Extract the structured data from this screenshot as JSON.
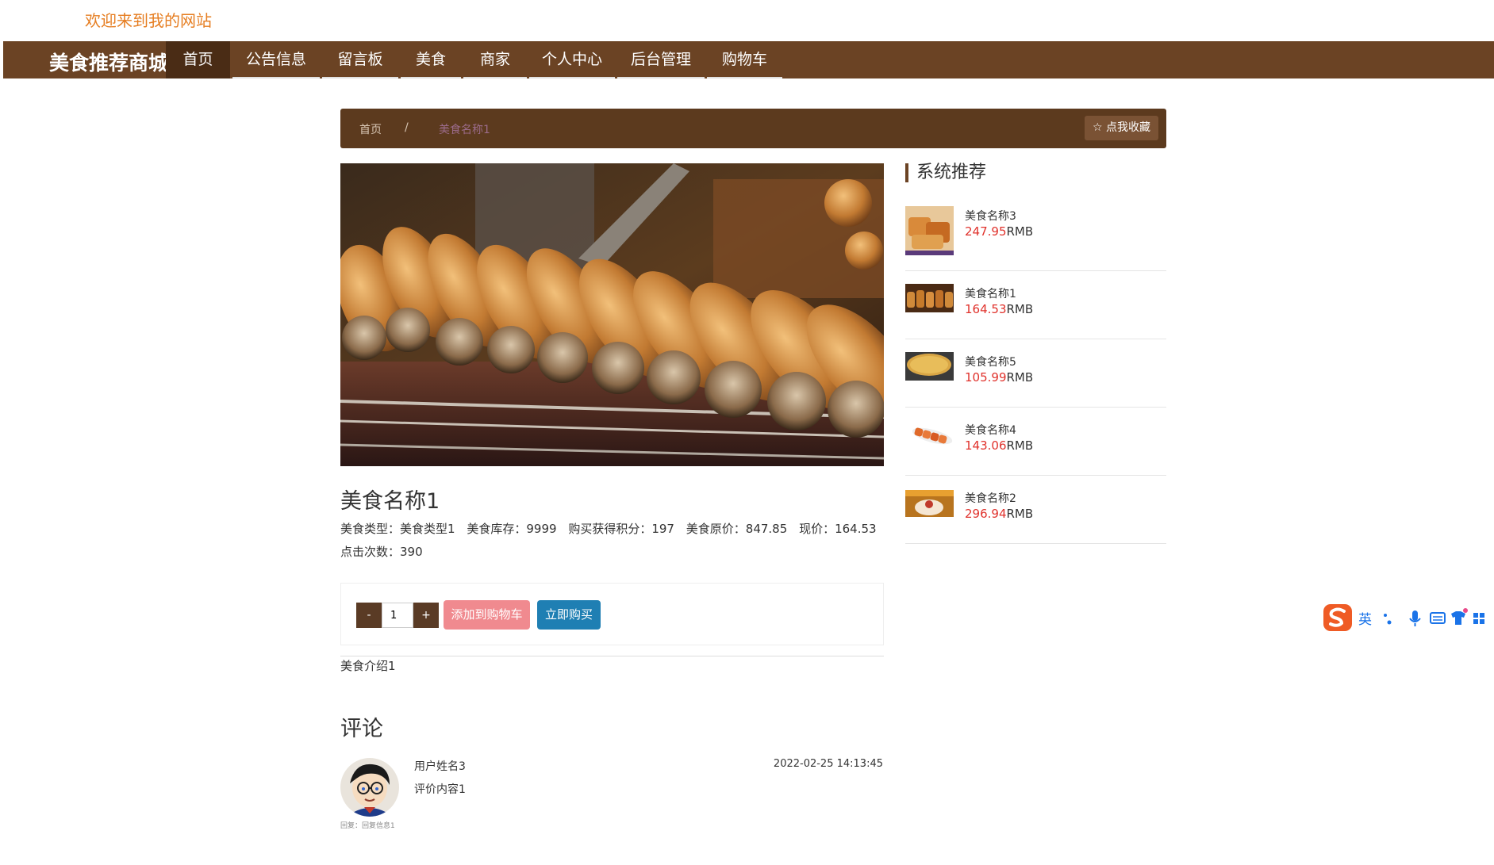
{
  "header": {
    "welcome": "欢迎来到我的网站"
  },
  "navbar": {
    "brand": "美食推荐商城",
    "items": [
      {
        "label": "首页"
      },
      {
        "label": "公告信息"
      },
      {
        "label": "留言板"
      },
      {
        "label": "美食"
      },
      {
        "label": "商家"
      },
      {
        "label": "个人中心"
      },
      {
        "label": "后台管理"
      },
      {
        "label": "购物车"
      }
    ]
  },
  "breadcrumb": {
    "home": "首页",
    "separator": "/",
    "current": "美食名称1",
    "favorite": "☆ 点我收藏"
  },
  "product": {
    "name": "美食名称1",
    "type_label": "美食类型：",
    "type_value": "美食类型1",
    "stock_label": "美食库存：",
    "stock_value": "9999",
    "points_label": "购买获得积分：",
    "points_value": "197",
    "orig_label": "美食原价：",
    "orig_value": "847.85",
    "price_label": "现价：",
    "price_value": "164.53",
    "clicks_label": "点击次数：",
    "clicks_value": "390",
    "description": "美食介绍1"
  },
  "purchase": {
    "minus": "-",
    "qty": "1",
    "plus": "+",
    "add_to_cart": "添加到购物车",
    "buy_now": "立即购买"
  },
  "comments": {
    "title": "评论",
    "items": [
      {
        "user": "用户姓名3",
        "content": "评价内容1",
        "time": "2022-02-25 14:13:45",
        "reply": "回复：回复信息1"
      }
    ]
  },
  "recommend": {
    "title": "系统推荐",
    "items": [
      {
        "name": "美食名称3",
        "price": "247.95",
        "unit": "RMB"
      },
      {
        "name": "美食名称1",
        "price": "164.53",
        "unit": "RMB"
      },
      {
        "name": "美食名称5",
        "price": "105.99",
        "unit": "RMB"
      },
      {
        "name": "美食名称4",
        "price": "143.06",
        "unit": "RMB"
      },
      {
        "name": "美食名称2",
        "price": "296.94",
        "unit": "RMB"
      }
    ]
  },
  "ime": {
    "label": "英"
  },
  "colors": {
    "brand": "#6b4324",
    "accent": "#e67e22",
    "price": "#e0312b",
    "cart": "#f08a8f",
    "buy": "#1f7fb3"
  }
}
